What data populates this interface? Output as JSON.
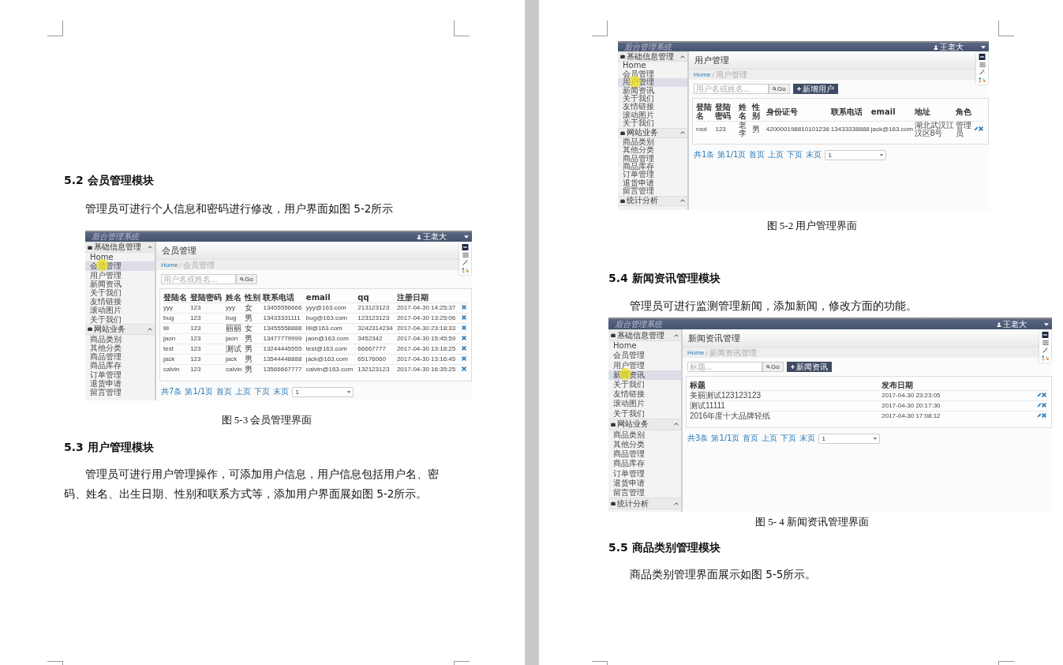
{
  "pages": [
    {
      "blocks": [
        {
          "kind": "heading",
          "text": "5.2 会员管理模块"
        },
        {
          "kind": "paragraph",
          "text": "管理员可进行个人信息和密码进行修改，用户界面如图 5-2所示"
        },
        {
          "kind": "figure",
          "app": {
            "brand": "后台管理系统",
            "user": "王老大",
            "sidebar": [
              {
                "label": "基础信息管理",
                "items": [
                  {
                    "label": "Home",
                    "selected": false
                  },
                  {
                    "label": "会员管理",
                    "selected": true
                  },
                  {
                    "label": "用户管理",
                    "selected": false
                  },
                  {
                    "label": "新闻资讯",
                    "selected": false
                  },
                  {
                    "label": "关于我们",
                    "selected": false
                  },
                  {
                    "label": "友情链接",
                    "selected": false
                  },
                  {
                    "label": "滚动图片",
                    "selected": false
                  },
                  {
                    "label": "关于我们",
                    "selected": false
                  }
                ]
              },
              {
                "label": "网站业务",
                "items": [
                  {
                    "label": "商品类别",
                    "selected": false
                  },
                  {
                    "label": "其他分类",
                    "selected": false
                  },
                  {
                    "label": "商品管理",
                    "selected": false
                  },
                  {
                    "label": "商品库存",
                    "selected": false
                  },
                  {
                    "label": "订单管理",
                    "selected": false
                  },
                  {
                    "label": "退货申请",
                    "selected": false
                  },
                  {
                    "label": "留言管理",
                    "selected": false
                  }
                ]
              }
            ],
            "title": "会员管理",
            "breadcrumb": [
              "Home",
              "会员管理"
            ],
            "search": {
              "placeholder": "用户名或姓名...",
              "button": "Go"
            },
            "table": {
              "columns": [
                "登陆名",
                "登陆密码",
                "姓名",
                "性别",
                "联系电话",
                "email",
                "qq",
                "注册日期"
              ],
              "editable": false,
              "rows": [
                [
                  "yyy",
                  "123",
                  "yyy",
                  "女",
                  "13455556666",
                  "yyy@163.com",
                  "213123123",
                  "2017-04-30 14:25:37"
                ],
                [
                  "bug",
                  "123",
                  "bug",
                  "男",
                  "13433331111",
                  "bug@163.com",
                  "123123123",
                  "2017-04-30 13:25:06"
                ],
                [
                  "lili",
                  "123",
                  "丽丽",
                  "女",
                  "13455558888",
                  "lili@163.com",
                  "3242314234",
                  "2017-04-30 23:18:33"
                ],
                [
                  "jaon",
                  "123",
                  "jaon",
                  "男",
                  "13477779999",
                  "jaon@163.com",
                  "3452342",
                  "2017-04-30 15:45:59"
                ],
                [
                  "test",
                  "123",
                  "测试",
                  "男",
                  "13244445555",
                  "test@163.com",
                  "66667777",
                  "2017-04-30 13:18:25"
                ],
                [
                  "jack",
                  "123",
                  "jack",
                  "男",
                  "13544448888",
                  "jack@163.com",
                  "65176060",
                  "2017-04-30 13:16:45"
                ],
                [
                  "calvin",
                  "123",
                  "calvin",
                  "男",
                  "13566667777",
                  "calvin@163.com",
                  "132123123",
                  "2017-04-30 16:35:25"
                ]
              ]
            },
            "pagination": [
              "共7条",
              "第1/1页",
              "首页",
              "上页",
              "下页",
              "末页"
            ],
            "page_select": "1"
          }
        },
        {
          "kind": "caption",
          "text": "图 5-3 会员管理界面"
        },
        {
          "kind": "heading",
          "text": "5.3 用户管理模块"
        },
        {
          "kind": "paragraph",
          "text": "管理员可进行用户管理操作，可添加用户信息，用户信息包括用户名、密码、姓名、出生日期、性别和联系方式等，添加用户界面展如图 5-2所示。"
        }
      ]
    },
    {
      "blocks": [
        {
          "kind": "figure",
          "app": {
            "brand": "后台管理系统",
            "user": "王老大",
            "sidebar": [
              {
                "label": "基础信息管理",
                "items": [
                  {
                    "label": "Home",
                    "selected": false
                  },
                  {
                    "label": "会员管理",
                    "selected": false
                  },
                  {
                    "label": "用户管理",
                    "selected": true
                  },
                  {
                    "label": "新闻资讯",
                    "selected": false
                  },
                  {
                    "label": "关于我们",
                    "selected": false
                  },
                  {
                    "label": "友情链接",
                    "selected": false
                  },
                  {
                    "label": "滚动图片",
                    "selected": false
                  },
                  {
                    "label": "关于我们",
                    "selected": false
                  }
                ]
              },
              {
                "label": "网站业务",
                "items": [
                  {
                    "label": "商品类别",
                    "selected": false
                  },
                  {
                    "label": "其他分类",
                    "selected": false
                  },
                  {
                    "label": "商品管理",
                    "selected": false
                  },
                  {
                    "label": "商品库存",
                    "selected": false
                  },
                  {
                    "label": "订单管理",
                    "selected": false
                  },
                  {
                    "label": "退货申请",
                    "selected": false
                  },
                  {
                    "label": "留言管理",
                    "selected": false
                  }
                ]
              },
              {
                "label": "统计分析"
              }
            ],
            "title": "用户管理",
            "breadcrumb": [
              "Home",
              "用户管理"
            ],
            "search": {
              "placeholder": "用户名或姓名...",
              "button": "Go"
            },
            "add_button": "新增用户",
            "table": {
              "columns": [
                "登陆名",
                "登陆密码",
                "姓名",
                "性别",
                "身份证号",
                "联系电话",
                "email",
                "地址",
                "角色"
              ],
              "editable": true,
              "rows": [
                [
                  "root",
                  "123",
                  "老李",
                  "男",
                  "420000198810101236",
                  "13433338888",
                  "jack@163.com",
                  "湖北武汉江汉区8号",
                  "管理员"
                ]
              ]
            },
            "pagination": [
              "共1条",
              "第1/1页",
              "首页",
              "上页",
              "下页",
              "末页"
            ],
            "page_select": "1"
          }
        },
        {
          "kind": "caption",
          "text": "图 5-2 用户管理界面"
        },
        {
          "kind": "heading",
          "text": "5.4 新闻资讯管理模块"
        },
        {
          "kind": "paragraph",
          "text": "管理员可进行监测管理新闻，添加新闻，修改方面的功能。"
        },
        {
          "kind": "figure",
          "app": {
            "brand": "后台管理系统",
            "user": "王老大",
            "sidebar": [
              {
                "label": "基础信息管理",
                "items": [
                  {
                    "label": "Home",
                    "selected": false
                  },
                  {
                    "label": "会员管理",
                    "selected": false
                  },
                  {
                    "label": "用户管理",
                    "selected": false
                  },
                  {
                    "label": "新闻资讯",
                    "selected": true
                  },
                  {
                    "label": "关于我们",
                    "selected": false
                  },
                  {
                    "label": "友情链接",
                    "selected": false
                  },
                  {
                    "label": "滚动图片",
                    "selected": false
                  },
                  {
                    "label": "关于我们",
                    "selected": false
                  }
                ]
              },
              {
                "label": "网站业务",
                "items": [
                  {
                    "label": "商品类别",
                    "selected": false
                  },
                  {
                    "label": "其他分类",
                    "selected": false
                  },
                  {
                    "label": "商品管理",
                    "selected": false
                  },
                  {
                    "label": "商品库存",
                    "selected": false
                  },
                  {
                    "label": "订单管理",
                    "selected": false
                  },
                  {
                    "label": "退货申请",
                    "selected": false
                  },
                  {
                    "label": "留言管理",
                    "selected": false
                  }
                ]
              },
              {
                "label": "统计分析"
              }
            ],
            "title": "新闻资讯管理",
            "breadcrumb": [
              "Home",
              "新闻资讯管理"
            ],
            "search": {
              "placeholder": "标题...",
              "button": "Go"
            },
            "add_button": "新闻资讯",
            "table": {
              "columns": [
                "标题",
                "发布日期"
              ],
              "editable": true,
              "rows": [
                [
                  "美丽测试123123123",
                  "2017-04-30 23:23:05"
                ],
                [
                  "测试11111",
                  "2017-04-30 20:17:30"
                ],
                [
                  "2016年度十大品牌轻纸",
                  "2017-04-30 17:08:12"
                ]
              ]
            },
            "pagination": [
              "共3条",
              "第1/1页",
              "首页",
              "上页",
              "下页",
              "末页"
            ],
            "page_select": "1"
          }
        },
        {
          "kind": "caption",
          "text": "图 5- 4 新闻资讯管理界面"
        },
        {
          "kind": "heading",
          "text": "5.5 商品类别管理模块"
        },
        {
          "kind": "paragraph",
          "text": "商品类别管理界面展示如图 5-5所示。"
        }
      ]
    }
  ]
}
